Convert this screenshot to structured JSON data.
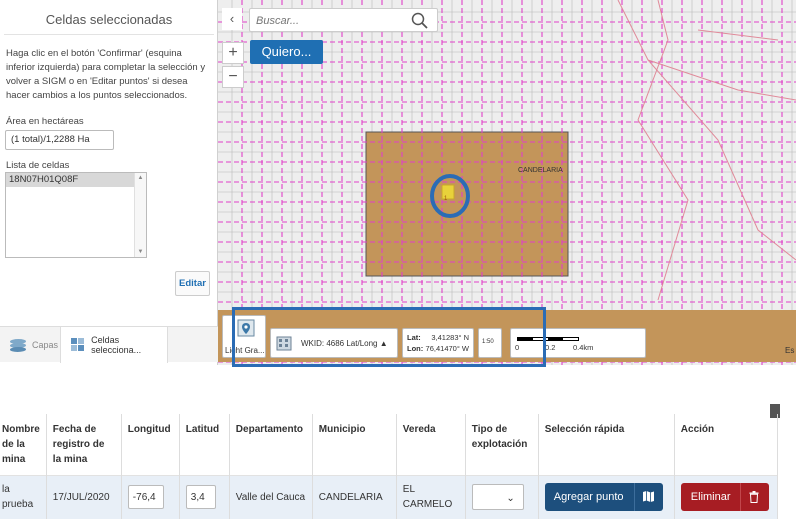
{
  "left_panel": {
    "title": "Celdas seleccionadas",
    "instructions": "Haga clic en el botón 'Confirmar' (esquina inferior izquierda) para completar la selección y volver a SIGM o en 'Editar puntos' si desea hacer cambios a los puntos seleccionados.",
    "area_label": "Área en hectáreas",
    "area_value": "(1 total)/1,2288 Ha",
    "cells_label": "Lista de celdas",
    "cells": [
      "18N07H01Q08F"
    ],
    "edit_label": "Editar",
    "tabs": [
      {
        "label": "Capas",
        "icon": "layers-icon"
      },
      {
        "label": "Celdas selecciona...",
        "icon": "cells-icon"
      }
    ]
  },
  "map": {
    "search_placeholder": "Buscar...",
    "quiero_label": "Quiero...",
    "zoom_in": "+",
    "zoom_out": "−",
    "collapse": "‹",
    "polygon_label": "CANDELARIA",
    "parcel_marker": "1",
    "edge_text": "Es",
    "status_bar": {
      "basemap_label": "Light Gra...",
      "wkid": "WKID: 4686 Lat/Long ▲",
      "lat_label": "Lat:",
      "lat_value": "3,41283° N",
      "lon_label": "Lon:",
      "lon_value": "76,41470° W",
      "view_label": "1:50",
      "scale_labels": [
        "0",
        "0.2",
        "0.4km"
      ]
    }
  },
  "table": {
    "headers": [
      "Nombre de la mina",
      "Fecha de registro de la mina",
      "Longitud",
      "Latitud",
      "Departamento",
      "Municipio",
      "Vereda",
      "Tipo de explotación",
      "Selección rápida",
      "Acción"
    ],
    "row": {
      "nombre": "la prueba",
      "fecha": "17/JUL/2020",
      "longitud": "-76,4",
      "latitud": "3,4",
      "departamento": "Valle del Cauca",
      "municipio": "CANDELARIA",
      "vereda": "EL CARMELO",
      "tipo": "",
      "add_point_label": "Agregar punto",
      "delete_label": "Eliminar"
    }
  },
  "colors": {
    "accent": "#1f6fb3",
    "parcel": "#c3955a",
    "grid_line": "#e040c8",
    "highlight": "#2b6cb5",
    "delete": "#a71d23"
  }
}
